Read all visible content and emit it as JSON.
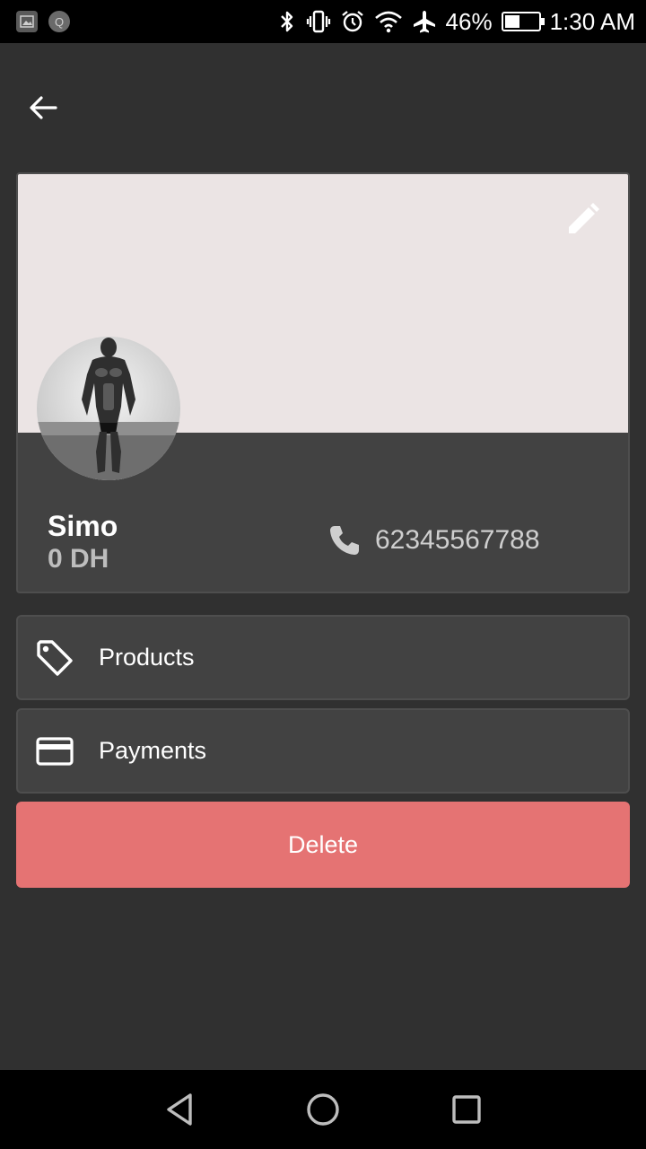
{
  "status_bar": {
    "left_icons": [
      "gallery-notification-icon",
      "q-notification-icon"
    ],
    "notif_q_letter": "Q",
    "right_icons": [
      "bluetooth-icon",
      "vibrate-icon",
      "alarm-icon",
      "wifi-icon",
      "airplane-mode-icon"
    ],
    "battery_percent": "46%",
    "battery_level": 0.46,
    "time": "1:30 AM"
  },
  "header": {
    "back_icon": "arrow-back-icon"
  },
  "profile": {
    "cover_color": "#ebe4e4",
    "edit_icon": "pencil-icon",
    "avatar_description": "profile photo",
    "name": "Simo",
    "balance": "0 DH",
    "phone_icon": "phone-icon",
    "phone": "62345567788"
  },
  "menu": {
    "items": [
      {
        "icon": "tag-icon",
        "label": "Products"
      },
      {
        "icon": "credit-card-icon",
        "label": "Payments"
      }
    ]
  },
  "actions": {
    "delete_label": "Delete",
    "delete_color": "#e57373"
  },
  "nav_bar": {
    "buttons": [
      "back-triangle-icon",
      "home-circle-icon",
      "recents-square-icon"
    ]
  }
}
